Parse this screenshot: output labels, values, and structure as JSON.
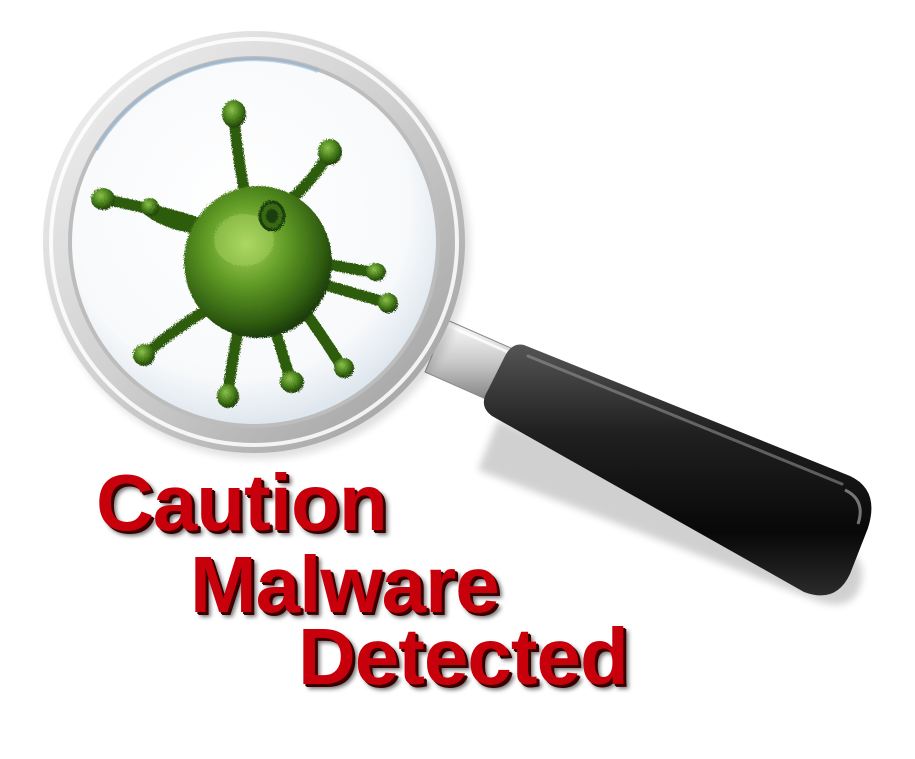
{
  "image": {
    "description_icons": [
      "magnifying-glass-icon",
      "virus-icon"
    ],
    "colors": {
      "headline": "#c8000b",
      "virus": "#4f8a1c",
      "handle": "#1a1a1a",
      "lens_rim": "#d9d9d9",
      "background": "#ffffff"
    }
  },
  "headline": {
    "line1": "Caution",
    "line2": "Malware",
    "line3": "Detected"
  }
}
